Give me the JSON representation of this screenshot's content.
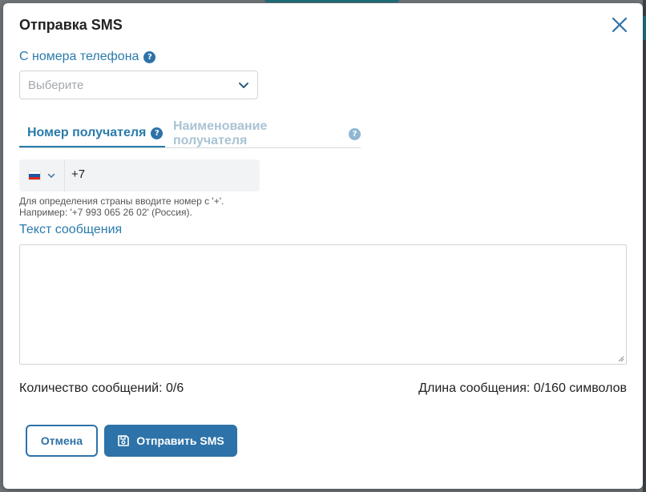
{
  "dialog": {
    "title": "Отправка SMS"
  },
  "from_phone": {
    "label": "С номера телефона",
    "help": "?",
    "placeholder": "Выберите"
  },
  "tabs": [
    {
      "label": "Номер получателя",
      "help": "?",
      "active": true
    },
    {
      "label": "Наименование получателя",
      "help": "?",
      "active": false
    }
  ],
  "phone_input": {
    "country": "Россия",
    "flag_colors": [
      "#ffffff",
      "#1c57a5",
      "#d52b1e"
    ],
    "value": "+7"
  },
  "hint": {
    "line1": "Для определения страны вводите номер с '+'.",
    "line2": "Например: '+7 993 065 26 02' (Россия)."
  },
  "message": {
    "label": "Текст сообщения",
    "value": ""
  },
  "stats": {
    "count": "Количество сообщений: 0/6",
    "length": "Длина сообщения:  0/160 символов"
  },
  "buttons": {
    "cancel": "Отмена",
    "send": "Отправить SMS"
  },
  "colors": {
    "accent": "#2d72a8",
    "label_blue": "#2a7bab",
    "inactive_tab": "#a9c3d3"
  }
}
